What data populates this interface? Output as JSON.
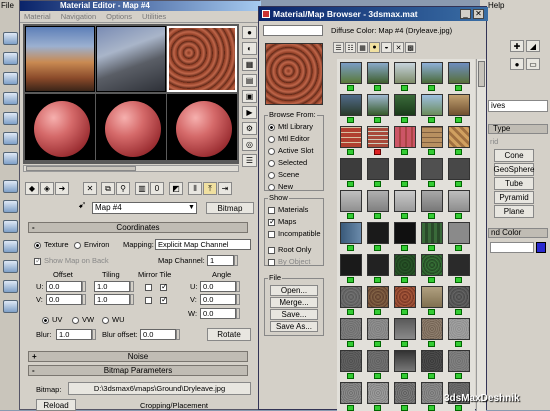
{
  "max": {
    "file_menu": "File",
    "help_menu": "Help",
    "right_panel": {
      "dropdown": "ives",
      "type_header": "Type",
      "auto_grid": "rid",
      "buttons": [
        "Cone",
        "GeoSphere",
        "Tube",
        "Pyramid",
        "Plane"
      ],
      "color_header": "nd Color"
    }
  },
  "material_editor": {
    "title": "Material Editor - Map #4",
    "menu": [
      "Material",
      "Navigation",
      "Options",
      "Utilities"
    ],
    "map_name": "Map #4",
    "map_type": "Bitmap",
    "coordinates": {
      "header": "Coordinates",
      "texture": "Texture",
      "environ": "Environ",
      "mapping_label": "Mapping:",
      "mapping_value": "Explicit Map Channel",
      "show_map": "Show Map on Back",
      "map_channel_label": "Map Channel:",
      "map_channel": "1",
      "offset_label": "Offset",
      "tiling_label": "Tiling",
      "mirror_tile_label": "Mirror Tile",
      "angle_label": "Angle",
      "u_label": "U:",
      "v_label": "V:",
      "w_label": "W:",
      "u_offset": "0.0",
      "v_offset": "0.0",
      "u_tiling": "1.0",
      "v_tiling": "1.0",
      "u_angle": "0.0",
      "v_angle": "0.0",
      "w_angle": "0.0",
      "uv": "UV",
      "vw": "VW",
      "wu": "WU",
      "blur_label": "Blur:",
      "blur": "1.0",
      "blur_offset_label": "Blur offset:",
      "blur_offset": "0.0",
      "rotate": "Rotate"
    },
    "noise_header": "Noise",
    "bitmap_params_header": "Bitmap Parameters",
    "bitmap_label": "Bitmap:",
    "bitmap_path": "D:\\3dsmax6\\maps\\Ground\\Dryleave.jpg",
    "reload": "Reload",
    "cropping": "Cropping/Placement"
  },
  "browser": {
    "title": "Material/Map Browser - 3dsmax.mat",
    "preview_label": "Diffuse Color: Map #4 (Dryleave.jpg)",
    "browse_from": "Browse From:",
    "browse_options": [
      "Mtl Library",
      "Mtl Editor",
      "Active Slot",
      "Selected",
      "Scene",
      "New"
    ],
    "show": "Show",
    "show_options": [
      "Materials",
      "Maps",
      "Incompatible"
    ],
    "root_only": "Root Only",
    "by_object": "By Object",
    "file": "File",
    "file_buttons": [
      "Open...",
      "Merge...",
      "Save...",
      "Save As..."
    ]
  },
  "watermark": "3dsMaxDeshnik"
}
